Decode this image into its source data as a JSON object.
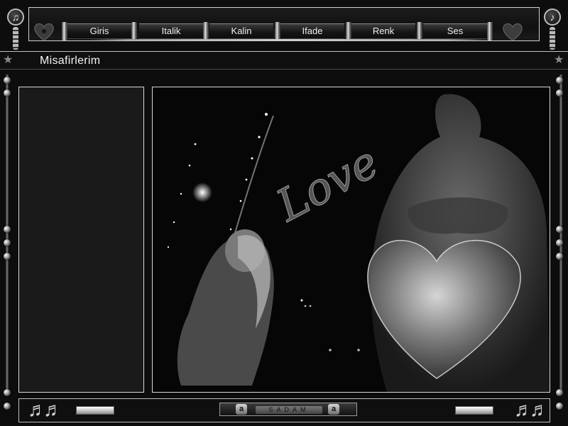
{
  "toolbar": {
    "buttons": [
      {
        "label": "Giris"
      },
      {
        "label": "Italik"
      },
      {
        "label": "Kalin"
      },
      {
        "label": "Ifade"
      },
      {
        "label": "Renk"
      },
      {
        "label": "Ses"
      }
    ]
  },
  "title": "Misafirlerim",
  "guest_list": {
    "items": []
  },
  "image": {
    "overlay_text": "Love"
  },
  "footer": {
    "brand_text": "SADAM",
    "badge_letter": "a"
  },
  "icons": {
    "top_left": "sound-icon",
    "top_right": "music-note-icon",
    "hearts": "heart-icon",
    "stars": "star-icon",
    "bottom_notes": "music-notes-icon"
  },
  "colors": {
    "background": "#0d0d0d",
    "frame": "#d8d8d8",
    "text": "#f0f0f0"
  }
}
